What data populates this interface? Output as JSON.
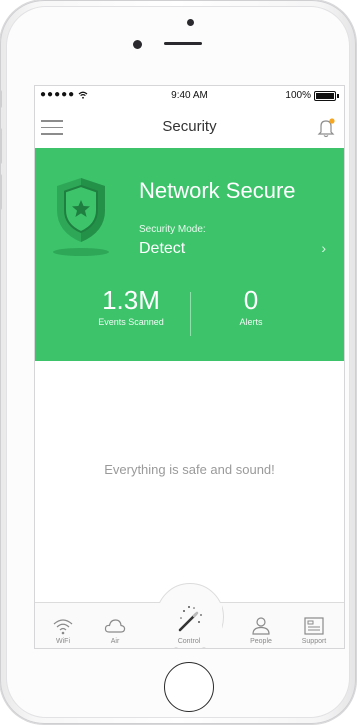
{
  "status_bar": {
    "signal": "●●●●●",
    "time": "9:40 AM",
    "battery": "100%"
  },
  "nav": {
    "title": "Security"
  },
  "hero": {
    "title": "Network Secure",
    "mode_label": "Security Mode:",
    "mode_value": "Detect",
    "chevron": "›",
    "stats": [
      {
        "value": "1.3M",
        "label": "Events Scanned"
      },
      {
        "value": "0",
        "label": "Alerts"
      }
    ]
  },
  "message": "Everything is safe and sound!",
  "tabs": [
    {
      "label": "WiFi",
      "icon": "wifi-icon"
    },
    {
      "label": "Air",
      "icon": "cloud-icon"
    },
    {
      "label": "Control",
      "icon": "magic-wand-icon"
    },
    {
      "label": "People",
      "icon": "person-icon"
    },
    {
      "label": "Support",
      "icon": "support-icon"
    }
  ],
  "colors": {
    "hero_green": "#3dc46b",
    "bell_badge": "#f5a623"
  }
}
